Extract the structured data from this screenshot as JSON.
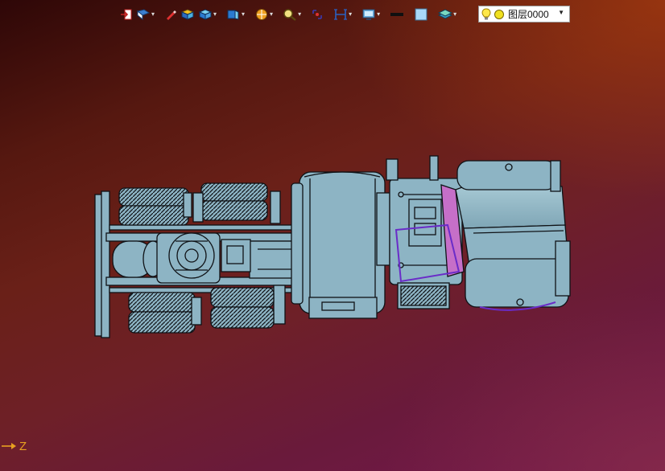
{
  "toolbar": {
    "items": [
      {
        "icon": "exit-icon",
        "dropdown": false
      },
      {
        "icon": "view-orientation-icon",
        "dropdown": true
      },
      {
        "icon": "pencil-icon",
        "dropdown": false
      },
      {
        "icon": "shaded-solid-icon",
        "dropdown": false
      },
      {
        "icon": "cube-icon",
        "dropdown": true
      },
      {
        "icon": "view-cube-icon",
        "dropdown": true
      },
      {
        "icon": "render-mode-icon",
        "dropdown": true
      },
      {
        "icon": "zoom-icon",
        "dropdown": true
      },
      {
        "icon": "zoom-fit-icon",
        "dropdown": false
      },
      {
        "icon": "section-view-icon",
        "dropdown": true
      },
      {
        "icon": "display-settings-icon",
        "dropdown": true
      },
      {
        "icon": "line-color-icon",
        "dropdown": false
      },
      {
        "icon": "background-color-icon",
        "dropdown": false
      },
      {
        "icon": "layer-stack-icon",
        "dropdown": true
      }
    ]
  },
  "layer": {
    "name": "图层0000",
    "icons": [
      "lightbulb-icon",
      "layer-status-icon"
    ]
  },
  "axis": {
    "label": "Z"
  },
  "colors": {
    "model_fill": "#8db4c4",
    "model_edge": "#0f1216",
    "highlight": "#c66fc8",
    "selection_edge": "#6a2cc8",
    "axis": "#e8a020"
  }
}
